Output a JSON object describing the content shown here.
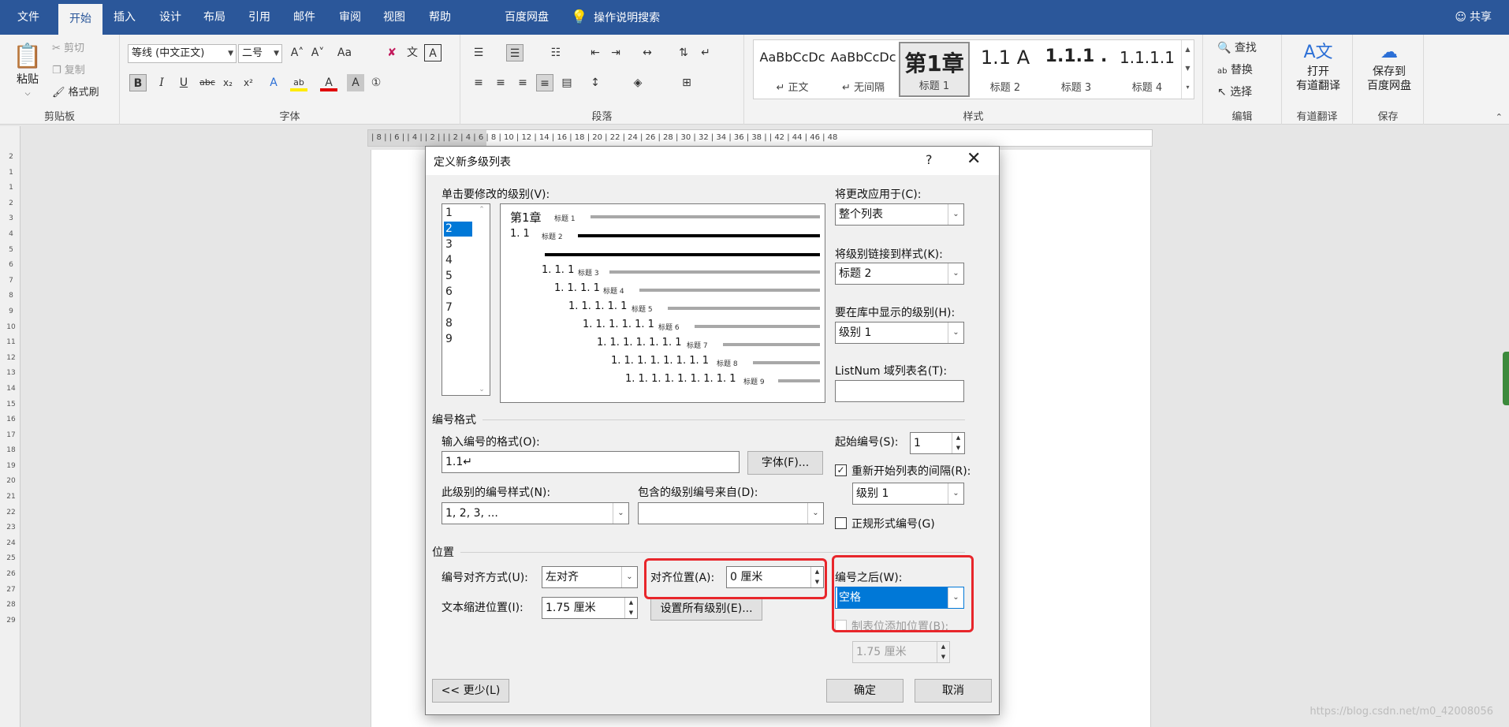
{
  "menubar": {
    "items": [
      "文件",
      "开始",
      "插入",
      "设计",
      "布局",
      "引用",
      "邮件",
      "审阅",
      "视图",
      "帮助",
      "百度网盘"
    ],
    "search": "操作说明搜索",
    "share": "共享"
  },
  "ribbon": {
    "clipboard": {
      "paste": "粘贴",
      "cut": "剪切",
      "copy": "复制",
      "format_painter": "格式刷",
      "label": "剪贴板"
    },
    "font": {
      "font_name": "等线 (中文正文)",
      "font_size": "二号",
      "label": "字体"
    },
    "paragraph": {
      "label": "段落"
    },
    "styles": {
      "label": "样式",
      "items": [
        {
          "sample": "AaBbCcDc",
          "name": "↵ 正文"
        },
        {
          "sample": "AaBbCcDc",
          "name": "↵ 无间隔"
        },
        {
          "sample": "第1章",
          "name": "标题 1"
        },
        {
          "sample": "1.1  A",
          "name": "标题 2"
        },
        {
          "sample": "1.1.1  .",
          "name": "标题 3"
        },
        {
          "sample": "1.1.1.1",
          "name": "标题 4"
        }
      ]
    },
    "editing": {
      "find": "查找",
      "replace": "替换",
      "select": "选择",
      "label": "编辑"
    },
    "translate": {
      "line1": "打开",
      "line2": "有道翻译",
      "label": "有道翻译"
    },
    "save": {
      "line1": "保存到",
      "line2": "百度网盘",
      "label": "保存"
    }
  },
  "ruler": {
    "ticks": "| 8 |   | 6 |   | 4 |   | 2 |   |     |  2  |  4  |  6  |  8  | 10 | 12 | 14 | 16 | 18 | 20 | 22 | 24 | 26 | 28 | 30 | 32 | 34 | 36 | 38 |   | 42 | 44 | 46 | 48",
    "vticks": [
      "2",
      "1",
      "1",
      "2",
      "3",
      "4",
      "5",
      "6",
      "7",
      "8",
      "9",
      "10",
      "11",
      "12",
      "13",
      "14",
      "15",
      "16",
      "17",
      "18",
      "19",
      "20",
      "21",
      "22",
      "23",
      "24",
      "25",
      "26",
      "27",
      "28",
      "29"
    ]
  },
  "dialog": {
    "title": "定义新多级列表",
    "help": "?",
    "close": "✕",
    "level_label": "单击要修改的级别(V):",
    "levels": [
      "1",
      "2",
      "3",
      "4",
      "5",
      "6",
      "7",
      "8",
      "9"
    ],
    "selected_level": "2",
    "preview": [
      {
        "num": "第1章",
        "tag": "标题 1"
      },
      {
        "num": "1. 1",
        "tag": "标题 2"
      },
      {
        "num": "",
        "tag": ""
      },
      {
        "num": "1. 1. 1",
        "tag": "标题 3"
      },
      {
        "num": "1. 1. 1. 1",
        "tag": "标题 4"
      },
      {
        "num": "1. 1. 1. 1. 1",
        "tag": "标题 5"
      },
      {
        "num": "1. 1. 1. 1. 1. 1",
        "tag": "标题 6"
      },
      {
        "num": "1. 1. 1. 1. 1. 1. 1",
        "tag": "标题 7"
      },
      {
        "num": "1. 1. 1. 1. 1. 1. 1. 1",
        "tag": "标题 8"
      },
      {
        "num": "1. 1. 1. 1. 1. 1. 1. 1. 1",
        "tag": "标题 9"
      }
    ],
    "apply_to_label": "将更改应用于(C):",
    "apply_to_value": "整个列表",
    "link_style_label": "将级别链接到样式(K):",
    "link_style_value": "标题 2",
    "gallery_level_label": "要在库中显示的级别(H):",
    "gallery_level_value": "级别 1",
    "listnum_label": "ListNum 域列表名(T):",
    "listnum_value": "",
    "number_format_section": "编号格式",
    "format_input_label": "输入编号的格式(O):",
    "format_input_value": "1.1↵",
    "font_button": "字体(F)...",
    "start_at_label": "起始编号(S):",
    "start_at_value": "1",
    "restart_label": "重新开始列表的间隔(R):",
    "restart_value": "级别 1",
    "legal_label": "正规形式编号(G)",
    "style_label": "此级别的编号样式(N):",
    "style_value": "1, 2, 3, ...",
    "include_label": "包含的级别编号来自(D):",
    "include_value": "",
    "position_section": "位置",
    "align_label": "编号对齐方式(U):",
    "align_value": "左对齐",
    "align_at_label": "对齐位置(A):",
    "align_at_value": "0 厘米",
    "indent_label": "文本缩进位置(I):",
    "indent_value": "1.75 厘米",
    "set_all_button": "设置所有级别(E)...",
    "follow_label": "编号之后(W):",
    "follow_value": "空格",
    "tab_stop_label": "制表位添加位置(B):",
    "tab_stop_value": "1.75 厘米",
    "less_button": "<< 更少(L)",
    "ok_button": "确定",
    "cancel_button": "取消"
  },
  "watermark": "https://blog.csdn.net/m0_42008056"
}
